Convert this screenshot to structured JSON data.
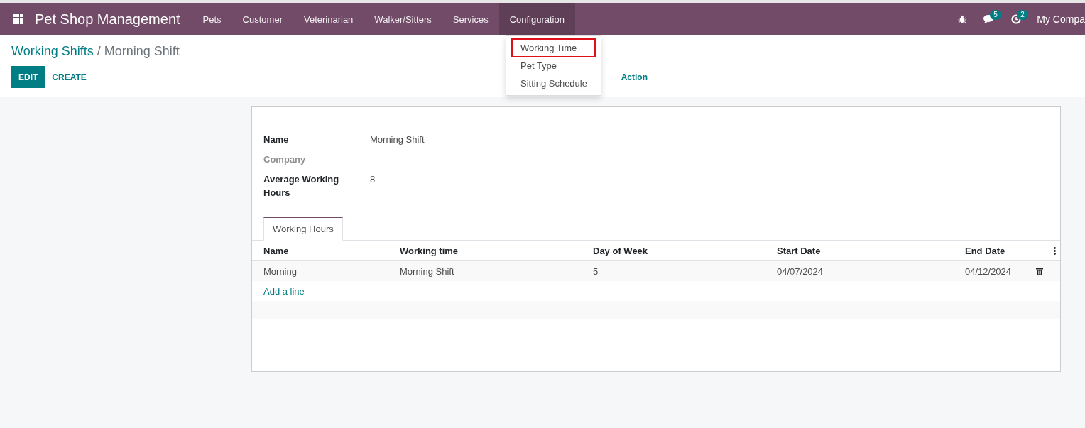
{
  "navbar": {
    "app_name": "Pet Shop Management",
    "menus": [
      {
        "label": "Pets",
        "open": false
      },
      {
        "label": "Customer",
        "open": false
      },
      {
        "label": "Veterinarian",
        "open": false
      },
      {
        "label": "Walker/Sitters",
        "open": false
      },
      {
        "label": "Services",
        "open": false
      },
      {
        "label": "Configuration",
        "open": true
      }
    ],
    "messages_count": "5",
    "activities_count": "2",
    "company": "My Compa"
  },
  "dropdown": {
    "items": [
      {
        "label": "Working Time",
        "selected": true
      },
      {
        "label": "Pet Type",
        "selected": false
      },
      {
        "label": "Sitting Schedule",
        "selected": false
      }
    ]
  },
  "control_panel": {
    "breadcrumb": [
      "Working Shifts",
      "Morning Shift"
    ],
    "separator": "/",
    "buttons": [
      {
        "label": "EDIT",
        "kind": "primary"
      },
      {
        "label": "CREATE",
        "kind": "link"
      }
    ],
    "action": "Action"
  },
  "form": {
    "fields": [
      {
        "label": "Name",
        "value": "Morning Shift",
        "muted": false
      },
      {
        "label": "Company",
        "muted": true
      },
      {
        "label": "Average Working Hours",
        "value": "8",
        "muted": false
      }
    ],
    "tabs": [
      {
        "label": "Working Hours",
        "selected": true
      }
    ],
    "table": {
      "columns": [
        "Name",
        "Working time",
        "Day of Week",
        "Start Date",
        "End Date"
      ],
      "rows": [
        [
          "Morning",
          "Morning Shift",
          "5",
          "04/07/2024",
          "04/12/2024"
        ]
      ],
      "add_line": "Add a line"
    }
  }
}
